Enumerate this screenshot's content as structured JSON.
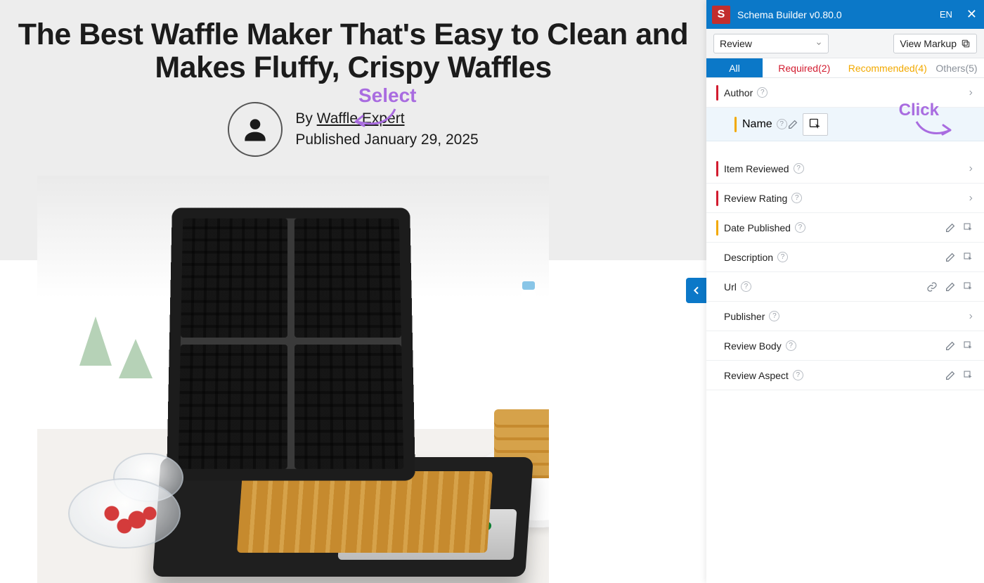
{
  "article": {
    "title": "The Best Waffle Maker That's Easy to Clean and Makes Fluffy, Crispy Waffles",
    "byline_prefix": "By ",
    "author_name": "Waffle Expert",
    "published_prefix": "Published ",
    "published_date": "January 29, 2025"
  },
  "annotations": {
    "select": "Select",
    "click": "Click"
  },
  "panel": {
    "titlebar": {
      "logo_letter": "S",
      "title": "Schema Builder v0.80.0",
      "lang": "EN"
    },
    "toolbar": {
      "schema_selected": "Review",
      "view_markup": "View Markup"
    },
    "tabs": {
      "all": "All",
      "required_label": "Required",
      "required_count": 2,
      "recommended_label": "Recommended",
      "recommended_count": 4,
      "others_label": "Others",
      "others_count": 5
    },
    "fields": {
      "author": "Author",
      "author_name": "Name",
      "item_reviewed": "Item Reviewed",
      "review_rating": "Review Rating",
      "date_published": "Date Published",
      "description": "Description",
      "url": "Url",
      "publisher": "Publisher",
      "review_body": "Review Body",
      "review_aspect": "Review Aspect"
    }
  }
}
